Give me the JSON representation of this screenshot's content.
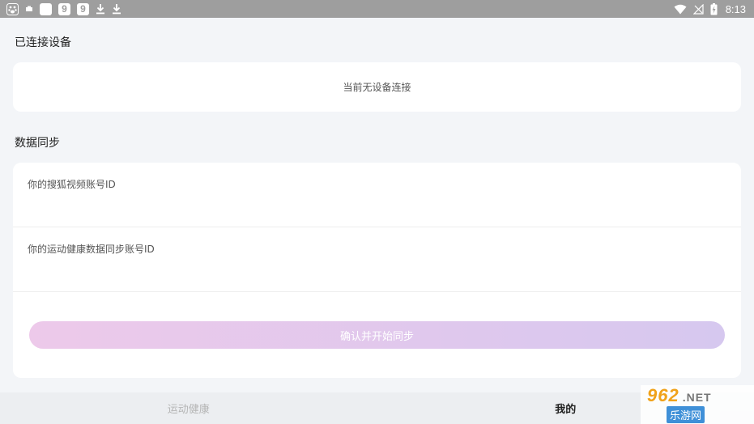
{
  "status_bar": {
    "time": "8:13",
    "left_icons": [
      "baidu-icon",
      "notification-icon",
      "square-app-icon",
      "app-9-icon",
      "app-9-icon",
      "download-icon",
      "download-icon"
    ],
    "right_icons": [
      "wifi-icon",
      "no-signal-icon",
      "battery-charging-icon"
    ]
  },
  "connected_devices": {
    "title": "已连接设备",
    "empty_text": "当前无设备连接"
  },
  "data_sync": {
    "title": "数据同步",
    "sohu_field": {
      "value": "",
      "placeholder": "你的搜狐视频账号ID"
    },
    "health_field": {
      "value": "",
      "placeholder": "你的运动健康数据同步账号ID"
    },
    "confirm_label": "确认并开始同步"
  },
  "tabs": [
    {
      "label": "运动健康",
      "active": false
    },
    {
      "label": "我的",
      "active": true
    }
  ],
  "watermark": {
    "brand": "962",
    "suffix": ".NET",
    "name": "乐游网"
  },
  "colors": {
    "button_gradient_start": "#edc9ea",
    "button_gradient_end": "#d6c8ef",
    "background": "#f3f5f8",
    "status_bar": "#9e9e9e"
  }
}
